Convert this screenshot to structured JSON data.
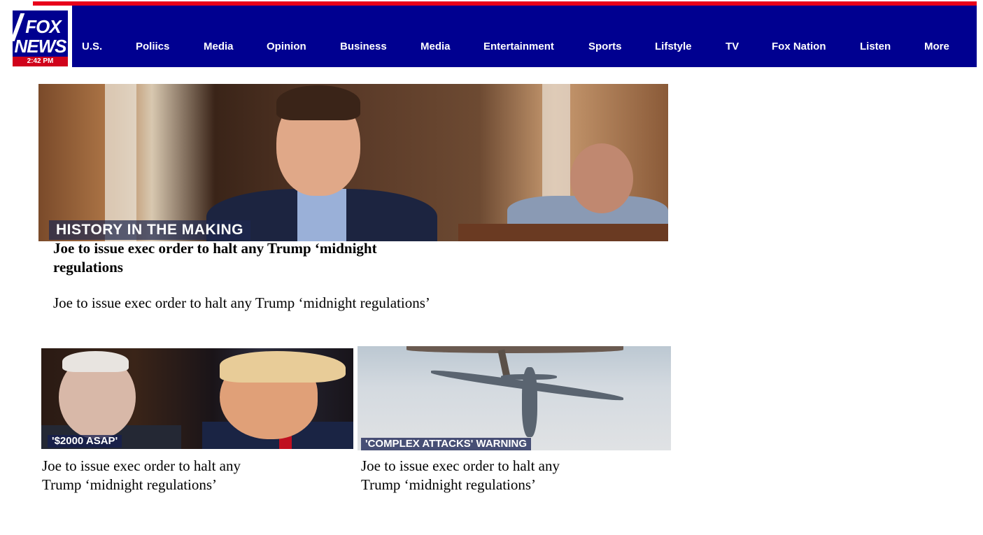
{
  "logo": {
    "top": "FOX",
    "bottom": "NEWS",
    "time": "2:42 PM"
  },
  "nav": {
    "items": [
      {
        "label": "U.S."
      },
      {
        "label": "Poliics"
      },
      {
        "label": "Media"
      },
      {
        "label": "Opinion"
      },
      {
        "label": "Business"
      },
      {
        "label": "Media"
      },
      {
        "label": "Entertainment"
      },
      {
        "label": "Sports"
      },
      {
        "label": "Lifstyle"
      },
      {
        "label": "TV"
      },
      {
        "label": "Fox Nation"
      },
      {
        "label": "Listen"
      },
      {
        "label": "More"
      }
    ]
  },
  "hero": {
    "banner": "HISTORY IN THE MAKING",
    "title": "Joe to issue exec order to halt any Trump ‘midnight regulations",
    "description": "Joe to issue exec order to halt any Trump ‘midnight regulations’"
  },
  "cards": [
    {
      "banner": "'$2000 ASAP'",
      "title": "Joe to issue exec order to halt any Trump ‘midnight regulations’"
    },
    {
      "banner": "'COMPLEX ATTACKS' WARNING",
      "title": "Joe to issue exec order to halt any Trump ‘midnight regulations’"
    }
  ],
  "colors": {
    "nav_background": "#000090",
    "accent_stripe": "#e8001b",
    "logo_time_bar": "#d0021b"
  }
}
